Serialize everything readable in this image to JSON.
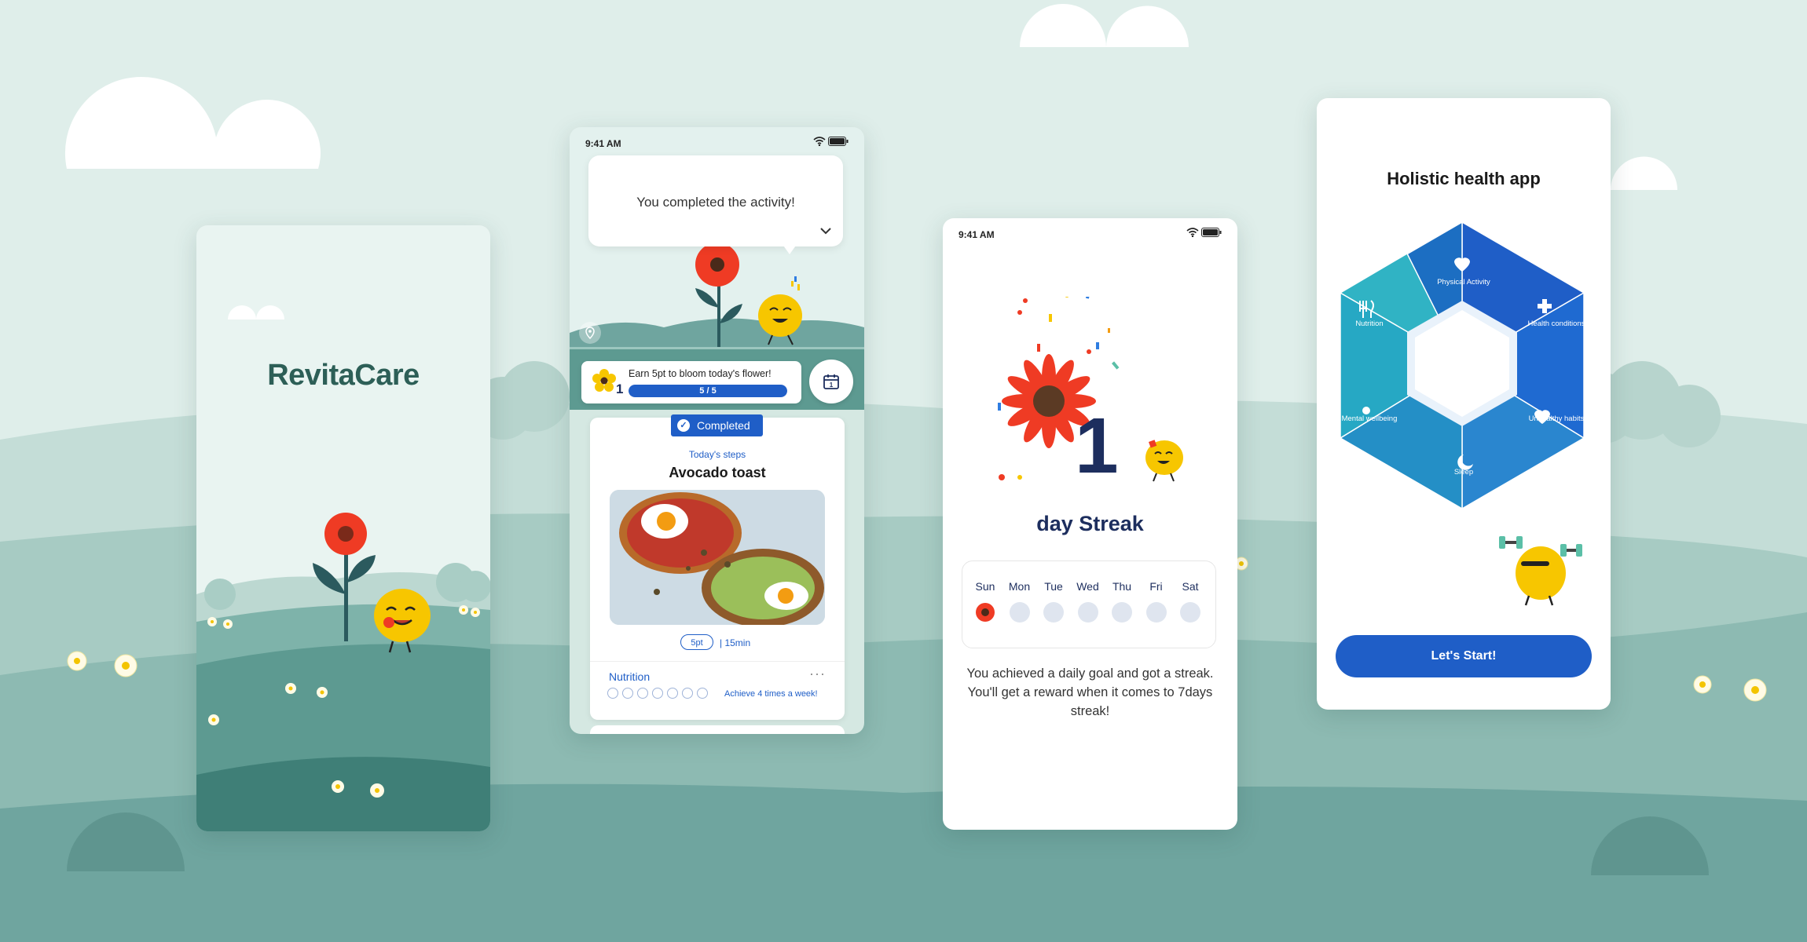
{
  "colors": {
    "background": "#dfeeea",
    "hills_dark": "#6fa59f",
    "accent_blue": "#1f5ec7",
    "navy": "#1d2e5e",
    "brand_green": "#2d5f57",
    "flower_red": "#ef3b24",
    "mascot_yellow": "#f7c600"
  },
  "splash": {
    "app_name": "RevitaCare"
  },
  "activity_screen": {
    "status_time": "9:41 AM",
    "bubble_text": "You completed the activity!",
    "progress": {
      "text": "Earn 5pt to bloom today's flower!",
      "count": "1",
      "bar_label": "5 / 5",
      "fraction": 1.0
    },
    "card": {
      "badge": "Completed",
      "subtitle": "Today's steps",
      "title": "Avocado toast",
      "points": "5pt",
      "duration": "| 15min",
      "category": "Nutrition",
      "menu": "···",
      "goal_circles": 7,
      "goal_text": "Achieve 4 times a week!"
    },
    "icons": [
      "wifi-icon",
      "battery-icon",
      "chevron-down-icon",
      "calendar-icon",
      "location-pin-icon",
      "checkmark-icon"
    ]
  },
  "streak_screen": {
    "status_time": "9:41 AM",
    "streak_number": "1",
    "streak_label": "day Streak",
    "days": [
      "Sun",
      "Mon",
      "Tue",
      "Wed",
      "Thu",
      "Fri",
      "Sat"
    ],
    "completed_days": [
      true,
      false,
      false,
      false,
      false,
      false,
      false
    ],
    "message": "You achieved a daily goal and got a streak. You'll get a reward when it comes to 7days streak!"
  },
  "holistic_screen": {
    "title": "Holistic health app",
    "segments": [
      {
        "label": "Physical Activity",
        "icon": "heart-pulse-icon"
      },
      {
        "label": "Health conditions",
        "icon": "medical-cross-icon"
      },
      {
        "label": "Unhealthy habits",
        "icon": "heart-alert-icon"
      },
      {
        "label": "Sleep",
        "icon": "moon-icon"
      },
      {
        "label": "Mental wellbeing",
        "icon": "sun-icon"
      },
      {
        "label": "Nutrition",
        "icon": "utensils-icon"
      }
    ],
    "cta": "Let's Start!"
  }
}
